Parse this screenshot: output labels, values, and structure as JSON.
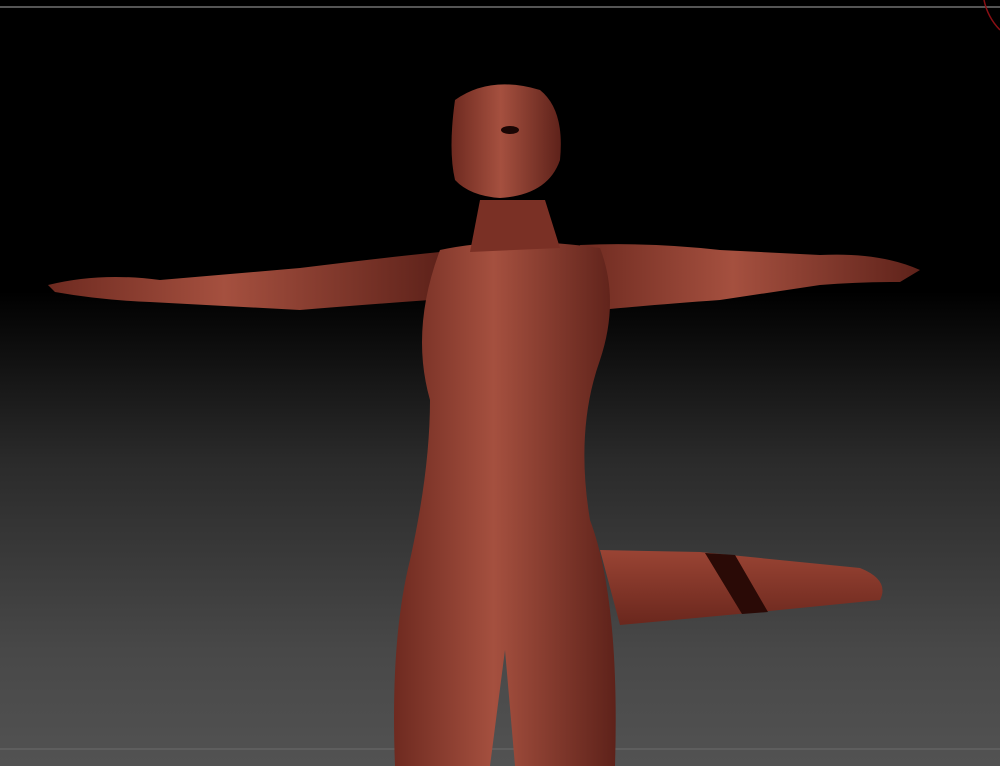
{
  "viewport": {
    "model_color": "#8a3a2e",
    "model_highlight": "#b5604f",
    "tail_band_color": "#2a0a06",
    "background_top": "#000000",
    "background_bottom": "#525252",
    "gizmo_color": "#8a0f14"
  },
  "icons": {
    "gizmo": "rotation-gizmo-arc"
  }
}
